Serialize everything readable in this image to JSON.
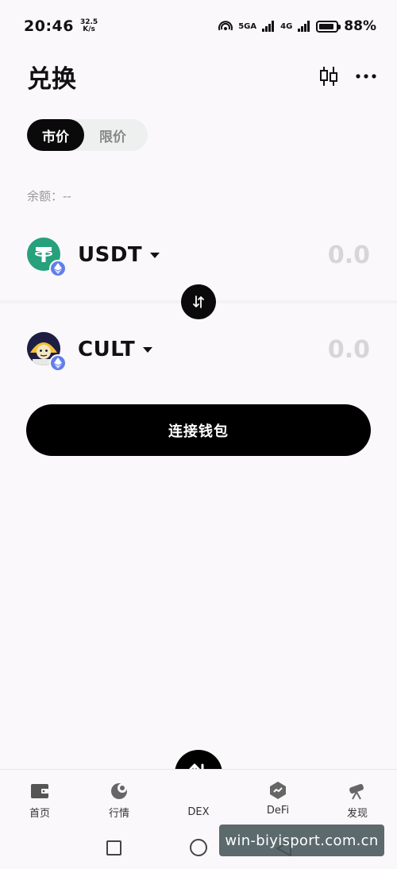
{
  "status_bar": {
    "time": "20:46",
    "speed_value": "32.5",
    "speed_unit": "K/s",
    "network_1": "5GA",
    "network_2": "4G",
    "battery_percent": "88%",
    "battery_level": 0.88
  },
  "header": {
    "title": "兑换",
    "chart_icon": "candlestick-icon",
    "more_icon": "more-icon"
  },
  "mode_toggle": {
    "market_label": "市价",
    "limit_label": "限价"
  },
  "balance": {
    "label": "余额：--"
  },
  "from_token": {
    "symbol": "USDT",
    "amount": "0.0",
    "logo_color": "#26a17b",
    "chain_icon": "ethereum-icon"
  },
  "to_token": {
    "symbol": "CULT",
    "amount": "0.0",
    "chain_icon": "ethereum-icon"
  },
  "swap_icon": "swap-arrows-icon",
  "connect_button": {
    "label": "连接钱包"
  },
  "tabbar": {
    "items": [
      {
        "label": "首页",
        "icon": "wallet-icon"
      },
      {
        "label": "行情",
        "icon": "market-icon"
      },
      {
        "label": "DEX",
        "icon": "dex-swap-icon"
      },
      {
        "label": "DeFi",
        "icon": "defi-icon"
      },
      {
        "label": "发现",
        "icon": "telescope-icon"
      }
    ]
  },
  "watermark": {
    "text": "win-biyisport.com.cn"
  },
  "colors": {
    "background": "#fbf8fb",
    "primary": "#000000",
    "muted": "#999999",
    "placeholder_amount": "#d6d6d6",
    "usdt_green": "#26a17b",
    "eth_blue": "#627eea"
  }
}
